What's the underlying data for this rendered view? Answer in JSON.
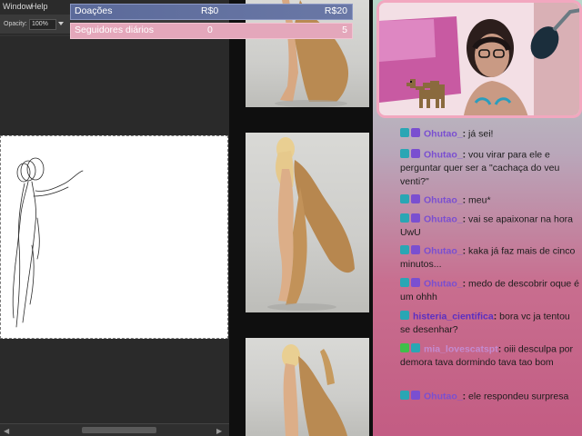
{
  "app": {
    "menu": [
      "Window",
      "Help"
    ],
    "options": {
      "opacity_label": "Opacity:",
      "opacity_value": "100%"
    }
  },
  "overlay": {
    "donations": {
      "label": "Doações",
      "current": "R$0",
      "goal": "R$20",
      "progress": 0
    },
    "followers": {
      "label": "Seguidores diários",
      "current": "0",
      "goal": "5",
      "progress": 0
    }
  },
  "chat": {
    "messages": [
      {
        "user": "Ohutao_",
        "text": "já sei!",
        "user_color": "#7a4fd0"
      },
      {
        "user": "Ohutao_",
        "text": "vou virar para ele e perguntar quer ser a \"cachaça do veu venti?\"",
        "user_color": "#7a4fd0"
      },
      {
        "user": "Ohutao_",
        "text": "meu*",
        "user_color": "#7a4fd0"
      },
      {
        "user": "Ohutao_",
        "text": "vai se apaixonar na hora UwU",
        "user_color": "#7a4fd0"
      },
      {
        "user": "Ohutao_",
        "text": "kaka já faz mais de cinco minutos...",
        "user_color": "#7a4fd0"
      },
      {
        "user": "Ohutao_",
        "text": "medo de descobrir oque é um ohhh",
        "user_color": "#7a4fd0"
      },
      {
        "user": "histeria_cientifica",
        "text": "bora vc ja tentou se desenhar?",
        "user_color": "#5a2fc2"
      },
      {
        "user": "mia_lovescatspt",
        "text": "oiii desculpa por demora tava dormindo tava tao bom",
        "user_color": "#c38bd0"
      },
      {
        "user": "Ohutao_",
        "text": "ele respondeu surpresa",
        "user_color": "#7a4fd0"
      }
    ]
  },
  "colors": {
    "donation_bar": "#5b6a9a",
    "follower_bar": "#e4a7bb",
    "webcam_border": "#f2a7bf",
    "chat_gradient_top": "#b8d6c9",
    "chat_gradient_bottom": "#c35c83"
  },
  "icons": [
    "twitch-badge-icon",
    "emote-badge-icon",
    "camel-pixel-icon",
    "microphone-icon"
  ]
}
